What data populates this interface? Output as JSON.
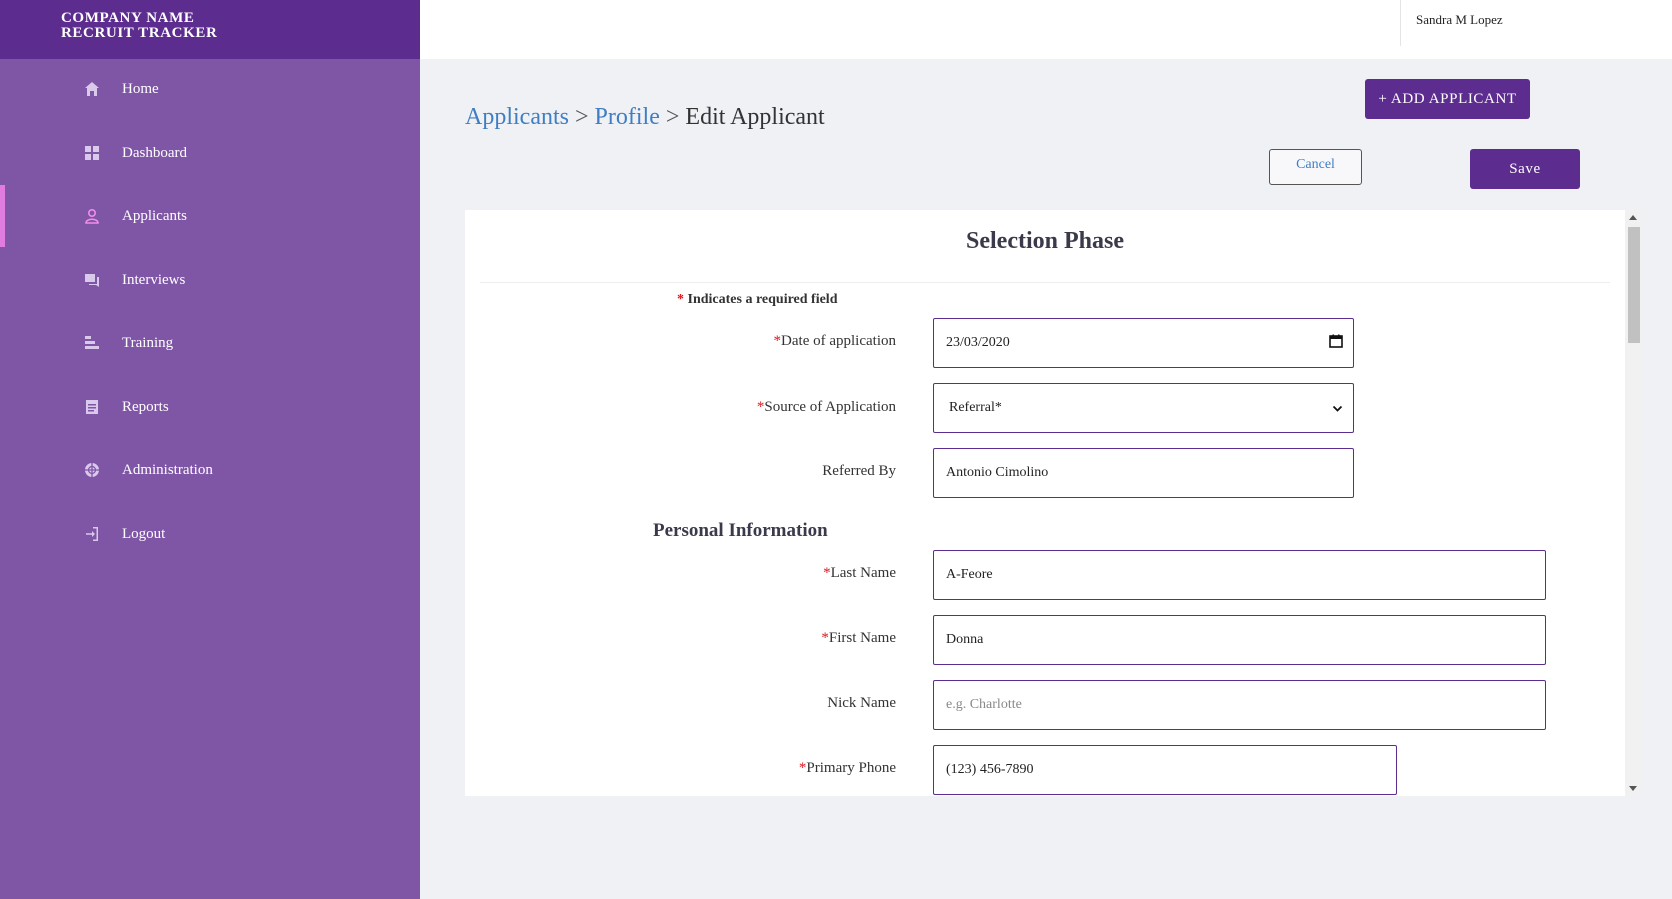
{
  "brand": {
    "line1": "COMPANY NAME",
    "line2": "RECRUIT TRACKER"
  },
  "sidebar": {
    "items": [
      {
        "label": "Home",
        "icon": "home-icon",
        "active": false
      },
      {
        "label": "Dashboard",
        "icon": "dashboard-icon",
        "active": false
      },
      {
        "label": "Applicants",
        "icon": "user-icon",
        "active": true
      },
      {
        "label": "Interviews",
        "icon": "chat-icon",
        "active": false
      },
      {
        "label": "Training",
        "icon": "training-icon",
        "active": false
      },
      {
        "label": "Reports",
        "icon": "report-icon",
        "active": false
      },
      {
        "label": "Administration",
        "icon": "globe-icon",
        "active": false
      },
      {
        "label": "Logout",
        "icon": "logout-icon",
        "active": false
      }
    ]
  },
  "header": {
    "user_name": "Sandra M Lopez"
  },
  "breadcrumb": {
    "part1": "Applicants",
    "sep1": ">",
    "part2": "Profile",
    "sep2": ">",
    "current": "Edit Applicant"
  },
  "actions": {
    "add_label": "+ ADD APPLICANT",
    "cancel_label": "Cancel",
    "save_label": "Save"
  },
  "form": {
    "title": "Selection Phase",
    "required_star": "*",
    "required_note": "Indicates a required field",
    "section_personal": "Personal Information",
    "date_label": "Date of application",
    "date_value": "23/03/2020",
    "source_label": "Source of Application",
    "source_value": "Referral*",
    "referred_label": "Referred By",
    "referred_value": "Antonio Cimolino",
    "last_name_label": "Last Name",
    "last_name_value": "A-Feore",
    "first_name_label": "First Name",
    "first_name_value": "Donna",
    "nick_name_label": "Nick Name",
    "nick_name_placeholder": "e.g. Charlotte",
    "phone_label": "Primary Phone",
    "phone_value": "(123) 456-7890"
  },
  "colors": {
    "sidebar": "#7f55a6",
    "brand": "#5c2d8e",
    "accent": "#5c2d8e",
    "link": "#3f7ec2",
    "active_marker": "#e07be0",
    "required": "#e0141e"
  }
}
